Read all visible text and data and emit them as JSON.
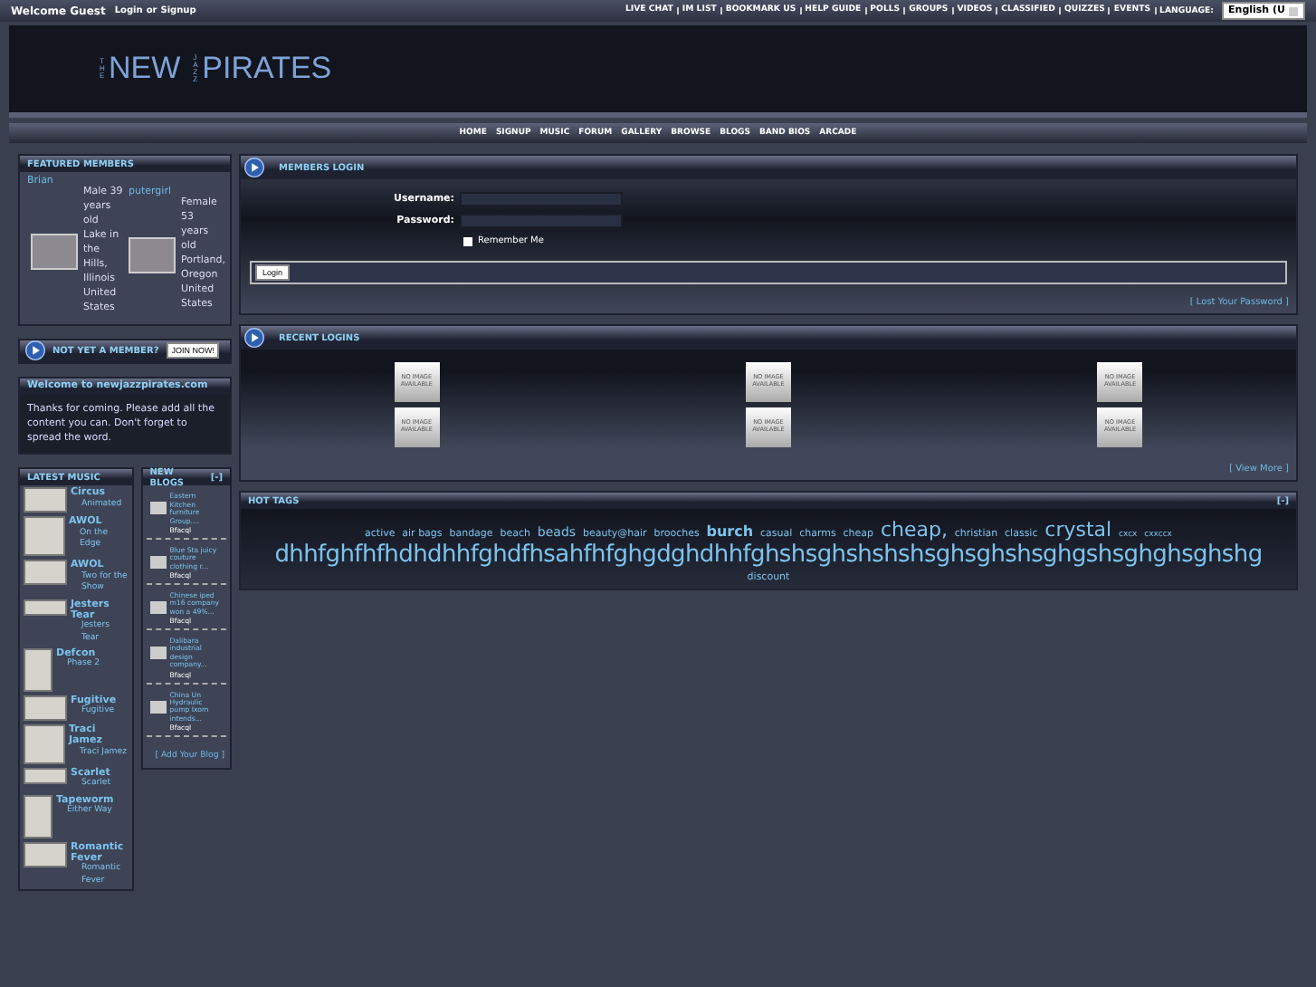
{
  "top_bar": {
    "welcome": "Welcome Guest",
    "login_link": "Login",
    "or": "or",
    "signup_link": "Signup",
    "links": [
      "LIVE CHAT",
      "IM LIST",
      "BOOKMARK US",
      "HELP GUIDE",
      "POLLS",
      "GROUPS",
      "VIDEOS",
      "CLASSIFIED",
      "QUIZZES",
      "EVENTS"
    ],
    "language_label": "LANGUAGE:",
    "language_value": "English (U"
  },
  "logo": {
    "the": "THE",
    "new": "NEW",
    "jazz": "JAZZ",
    "pirates": "PIRATES"
  },
  "nav": [
    "HOME",
    "SIGNUP",
    "MUSIC",
    "FORUM",
    "GALLERY",
    "BROWSE",
    "BLOGS",
    "BAND BIOS",
    "ARCADE"
  ],
  "featured_members": {
    "title": "FEATURED MEMBERS",
    "members": [
      {
        "name": "Brian",
        "details": "Male 39 years old Lake in the Hills, Illinois United States"
      },
      {
        "name": "putergirl",
        "details": "Female 53 years old Portland, Oregon United States"
      }
    ]
  },
  "not_member": {
    "title": "NOT YET A MEMBER?",
    "button": "JOIN NOW!"
  },
  "welcome_box": {
    "title": "Welcome to newjazzpirates.com",
    "text": "Thanks for coming. Please add all the content you can. Don't forget to spread the word."
  },
  "latest_music": {
    "title": "LATEST MUSIC",
    "items": [
      {
        "title": "Circus",
        "subtitle": "Animated",
        "kind": "wide"
      },
      {
        "title": "AWOL",
        "subtitle": "On the Edge",
        "kind": "square"
      },
      {
        "title": "AWOL",
        "subtitle": "Two for the Show",
        "kind": "wide"
      },
      {
        "title": "Jesters Tear",
        "subtitle": "Jesters Tear",
        "kind": "strip"
      },
      {
        "title": "Defcon",
        "subtitle": "Phase 2",
        "kind": "tall"
      },
      {
        "title": "Fugitive",
        "subtitle": "Fugitive",
        "kind": "wide"
      },
      {
        "title": "Traci Jamez",
        "subtitle": "Traci Jamez",
        "kind": "square"
      },
      {
        "title": "Scarlet",
        "subtitle": "Scarlet",
        "kind": "strip"
      },
      {
        "title": "Tapeworm",
        "subtitle": "Either Way",
        "kind": "tall"
      },
      {
        "title": "Romantic Fever",
        "subtitle": "Romantic Fever",
        "kind": "wide"
      }
    ]
  },
  "new_blogs": {
    "title": "NEW BLOGS",
    "toggle": "[-]",
    "items": [
      {
        "title": "Eastern Kitchen furniture Group....",
        "author": "Bfacql"
      },
      {
        "title": "Blue Sta juicy couture clothing r...",
        "author": "Bfacql"
      },
      {
        "title": "Chinese iped m16 company won a 49%...",
        "author": "Bfacql"
      },
      {
        "title": "Dalibara industrial design company...",
        "author": "Bfacql"
      },
      {
        "title": "China Un Hydraulic pump Ixom intends...",
        "author": "Bfacql"
      }
    ],
    "add_link": "[ Add Your Blog ]"
  },
  "members_login": {
    "title": "MEMBERS LOGIN",
    "username_label": "Username:",
    "password_label": "Password:",
    "remember_label": "Remember Me",
    "remember": false,
    "button": "Login",
    "lost_link": "[ Lost Your Password ]"
  },
  "recent_logins": {
    "title": "RECENT LOGINS",
    "photos": [
      {
        "caption": "NO IMAGE AVAILABLE"
      },
      {
        "caption": "NO IMAGE AVAILABLE"
      },
      {
        "caption": "NO IMAGE AVAILABLE"
      },
      {
        "caption": "NO IMAGE AVAILABLE"
      },
      {
        "caption": "NO IMAGE AVAILABLE"
      },
      {
        "caption": "NO IMAGE AVAILABLE"
      }
    ],
    "view_more": "[ View More ]"
  },
  "hot_tags": {
    "title": "HOT TAGS",
    "toggle": "[-]",
    "tags": [
      {
        "text": "active",
        "kind": "small"
      },
      {
        "text": "air bags",
        "kind": "small"
      },
      {
        "text": "bandage",
        "kind": "small"
      },
      {
        "text": "beach",
        "kind": "small"
      },
      {
        "text": "beads",
        "kind": "medium"
      },
      {
        "text": "beauty@hair",
        "kind": "small"
      },
      {
        "text": "brooches",
        "kind": "small"
      },
      {
        "text": "burch",
        "kind": "bold"
      },
      {
        "text": "casual",
        "kind": "small"
      },
      {
        "text": "charms",
        "kind": "small"
      },
      {
        "text": "cheap",
        "kind": "small"
      },
      {
        "text": "cheap,",
        "kind": "large"
      },
      {
        "text": "christian",
        "kind": "small"
      },
      {
        "text": "classic",
        "kind": "small"
      },
      {
        "text": "crystal",
        "kind": "large"
      },
      {
        "text": "cxcx",
        "kind": "tiny"
      },
      {
        "text": "cxxccx",
        "kind": "tiny"
      },
      {
        "text": "dhhfghfhfhdhdhhfghdfhsahfhfghgdghdhhfghshsghshshshsghsghshsghgshsghghsghshg",
        "kind": "huge"
      },
      {
        "text": "discount",
        "kind": "small"
      }
    ]
  }
}
